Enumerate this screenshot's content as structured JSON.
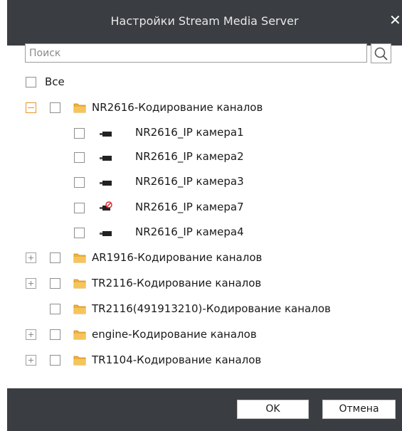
{
  "dialog": {
    "title": "Настройки Stream Media Server",
    "close_symbol": "✕"
  },
  "search": {
    "placeholder": "Поиск",
    "value": ""
  },
  "tree": {
    "all_label": "Все",
    "groups": [
      {
        "label": "NR2616-Кодирование каналов",
        "expanded": true,
        "children": [
          {
            "label": "NR2616_IP камера1",
            "icon": "camera-icon"
          },
          {
            "label": "NR2616_IP камера2",
            "icon": "camera-icon"
          },
          {
            "label": "NR2616_IP камера3",
            "icon": "camera-icon"
          },
          {
            "label": "NR2616_IP камера7",
            "icon": "camera-offline-icon"
          },
          {
            "label": "NR2616_IP камера4",
            "icon": "camera-icon"
          }
        ]
      },
      {
        "label": "AR1916-Кодирование каналов",
        "expanded": false
      },
      {
        "label": "TR2116-Кодирование каналов",
        "expanded": false
      },
      {
        "label": "TR2116(491913210)-Кодирование каналов",
        "expanded": null
      },
      {
        "label": "engine-Кодирование каналов",
        "expanded": false
      },
      {
        "label": "TR1104-Кодирование каналов",
        "expanded": false
      }
    ]
  },
  "footer": {
    "ok_label": "OK",
    "cancel_label": "Отмена"
  },
  "colors": {
    "titlebar": "#3a3d41",
    "expand_active": "#e8952c",
    "folder": "#f0b03c"
  }
}
